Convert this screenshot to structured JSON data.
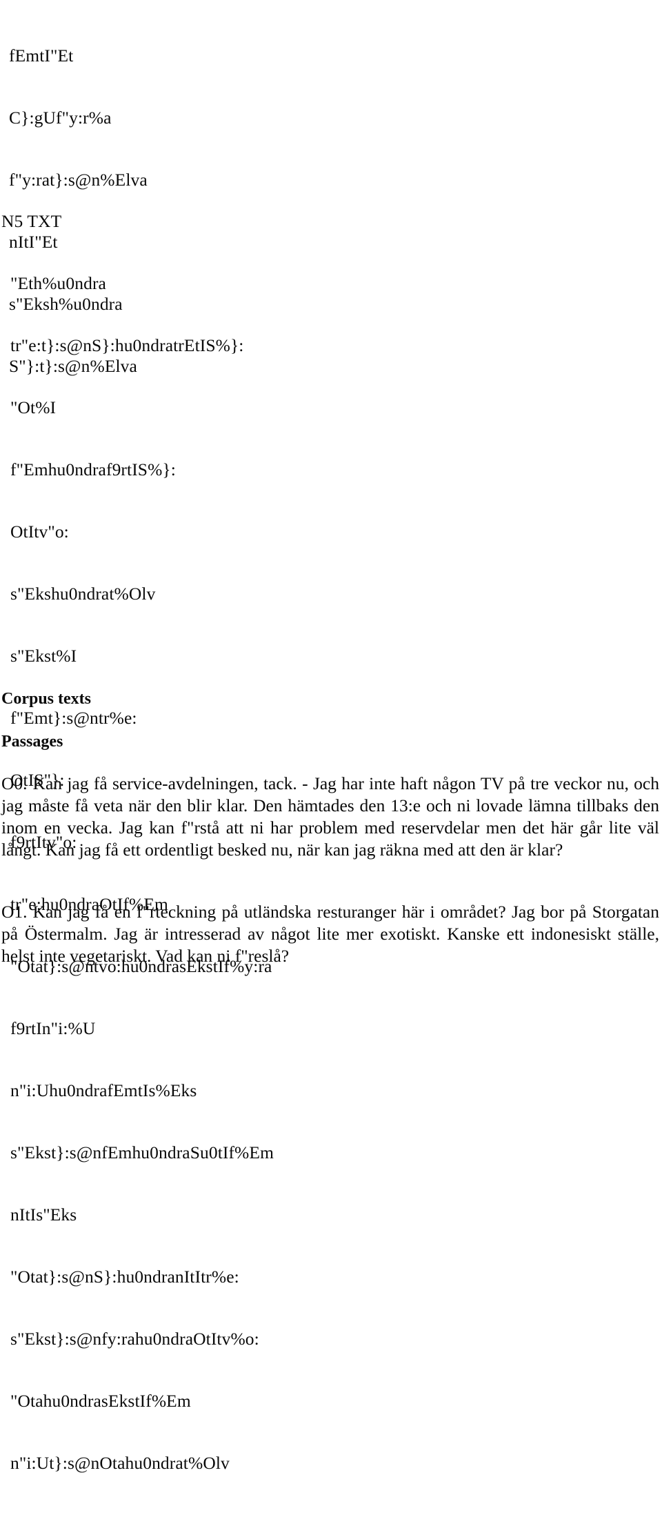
{
  "document": {
    "encoded_block_top": {
      "lines": [
        "fEmtI\"Et",
        "C}:gUf\"y:r%a",
        "f\"y:rat}:s@n%Elva",
        "nItI\"Et",
        "s\"Eksh%u0ndra",
        "S\"}:t}:s@n%Elva"
      ]
    },
    "encoded_block_n5": {
      "heading": "N5 TXT",
      "lines": [
        "\"Eth%u0ndra",
        "tr\"e:t}:s@nS}:hu0ndratrEtIS%}:",
        "\"Ot%I",
        "f\"Emhu0ndraf9rtIS%}:",
        "OtItv\"o:",
        "s\"Ekshu0ndrat%Olv",
        "s\"Ekst%I",
        "f\"Emt}:s@ntr%e:",
        "OtIS\"}:",
        "f9rtItv\"o:",
        "tr\"e:hu0ndraOtIf%Em",
        "\"Otat}:s@ntvo:hu0ndrasEkstIf%y:ra",
        "f9rtIn\"i:%U",
        "n\"i:Uhu0ndrafEmtIs%Eks",
        "s\"Ekst}:s@nfEmhu0ndraSu0tIf%Em",
        "nItIs\"Eks",
        "\"Otat}:s@nS}:hu0ndranItItr%e:",
        "s\"Ekst}:s@nfy:rahu0ndraOtItv%o:",
        "\"Otahu0ndrasEkstIf%Em",
        "n\"i:Ut}:s@nOtahu0ndrat%Olv"
      ]
    },
    "headings": {
      "corpus_texts": "Corpus texts",
      "passages": "Passages"
    },
    "passages": [
      {
        "label": "O0.",
        "text": "Kan jag få service-avdelningen, tack. - Jag har inte haft någon TV på tre veckor nu, och jag måste få veta när den  blir klar.  Den hämtades den 13:e och ni lovade lämna tillbaks  den  inom  en  vecka.  Jag  kan  f\"rstå  att  ni  har  problem  med reservdelar  men det här går lite väl långt. Kan  jag  få  ett ordentligt besked nu, när kan jag räkna med att den är klar?"
      },
      {
        "label": "O1.",
        "text": "Kan jag få en f\"rteckning på utländska resturanger här  i området? Jag bor på Storgatan på Östermalm. Jag är intresserad av  något  lite  mer exotiskt. Kanske ett indonesiskt  ställe, helst inte vegetariskt. Vad kan ni f\"reslå?"
      }
    ]
  }
}
